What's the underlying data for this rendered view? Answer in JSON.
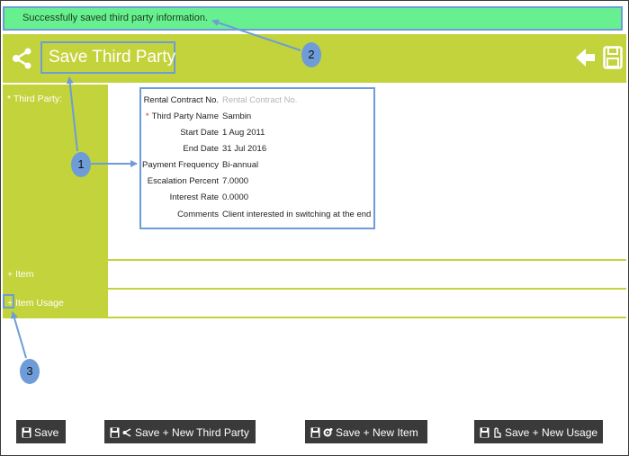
{
  "success_message": "Successfully saved third party information.",
  "header": {
    "title": "Save Third Party"
  },
  "sections": {
    "third_party": "Third Party:",
    "item": "Item",
    "item_usage": "Item Usage"
  },
  "section_markers": {
    "third_party": "*",
    "item": "+",
    "item_usage": "+"
  },
  "form": {
    "rental_contract_label": "Rental Contract No.",
    "rental_contract_placeholder": "Rental Contract No.",
    "required_marker": "*",
    "third_party_name_label": "Third Party Name",
    "third_party_name_value": "Sambin",
    "start_date_label": "Start Date",
    "start_date_value": "1 Aug 2011",
    "end_date_label": "End Date",
    "end_date_value": "31 Jul 2016",
    "payment_frequency_label": "Payment Frequency",
    "payment_frequency_value": "Bi-annual",
    "escalation_label": "Escalation Percent",
    "escalation_value": "7.0000",
    "interest_label": "Interest Rate",
    "interest_value": "0.0000",
    "comments_label": "Comments",
    "comments_value": "Client interested in switching at the end"
  },
  "callouts": {
    "one": "1",
    "two": "2",
    "three": "3"
  },
  "buttons": {
    "save": "Save",
    "save_new_third_party": "Save + New Third Party",
    "save_new_item": "Save + New Item",
    "save_new_usage": "Save + New Usage"
  },
  "colors": {
    "header": "#c3d33c",
    "success": "#67f08f",
    "callout": "#6e9cd8",
    "button": "#3a3a3a"
  },
  "icons": [
    "share-icon",
    "back-arrow-icon",
    "floppy-save-icon",
    "gear-icon",
    "touch-icon"
  ]
}
